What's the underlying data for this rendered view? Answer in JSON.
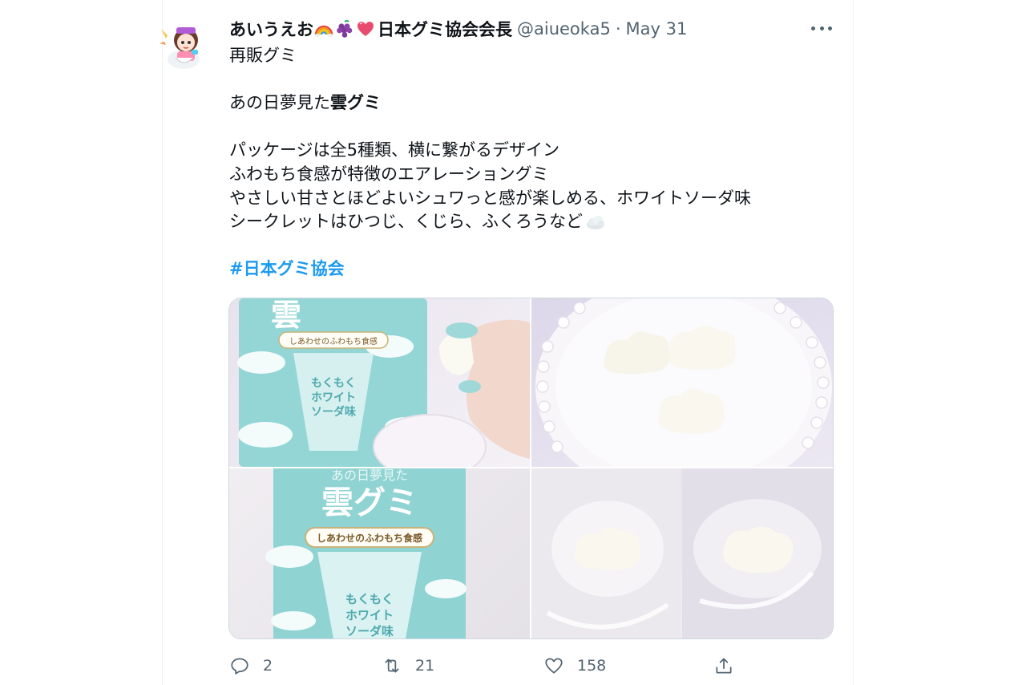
{
  "tweet": {
    "author_name": "あいうえお",
    "author_suffix": "日本グミ協会会長",
    "emojis": [
      "rainbow-icon",
      "grapes-icon",
      "heart-icon"
    ],
    "handle": "@aiueoka5",
    "separator": "·",
    "date": "May 31",
    "text_lines": {
      "l1": "再販グミ",
      "l2_prefix": "あの日夢見た",
      "l2_bold": "雲グミ",
      "l3": "パッケージは全5種類、横に繋がるデザイン",
      "l4": "ふわもち食感が特徴のエアレーショングミ",
      "l5": "やさしい甘さとほどよいシュワっと感が楽しめる、ホワイトソーダ味",
      "l6": "シークレットはひつじ、くじら、ふくろうなど"
    },
    "hashtag": "#日本グミ協会"
  },
  "media": {
    "images": [
      {
        "id": "photo-package-hand",
        "package_texts": [
          "雲",
          "しあわせのふわもち食感",
          "もくもく",
          "ホワイト",
          "ソーダ味"
        ]
      },
      {
        "id": "photo-gummies-on-plate"
      },
      {
        "id": "photo-package-front",
        "package_texts": [
          "あの日夢見た",
          "雲グミ",
          "しあわせのふわもち食感",
          "もくもく",
          "ホワイト",
          "ソーダ味"
        ]
      },
      {
        "id": "photo-gummy-closeups"
      }
    ]
  },
  "actions": {
    "reply_count": "2",
    "retweet_count": "21",
    "like_count": "158"
  },
  "colors": {
    "text": "#0f1419",
    "secondary": "#536471",
    "link": "#1d9bf0",
    "package_teal": "#8fd3d3"
  }
}
